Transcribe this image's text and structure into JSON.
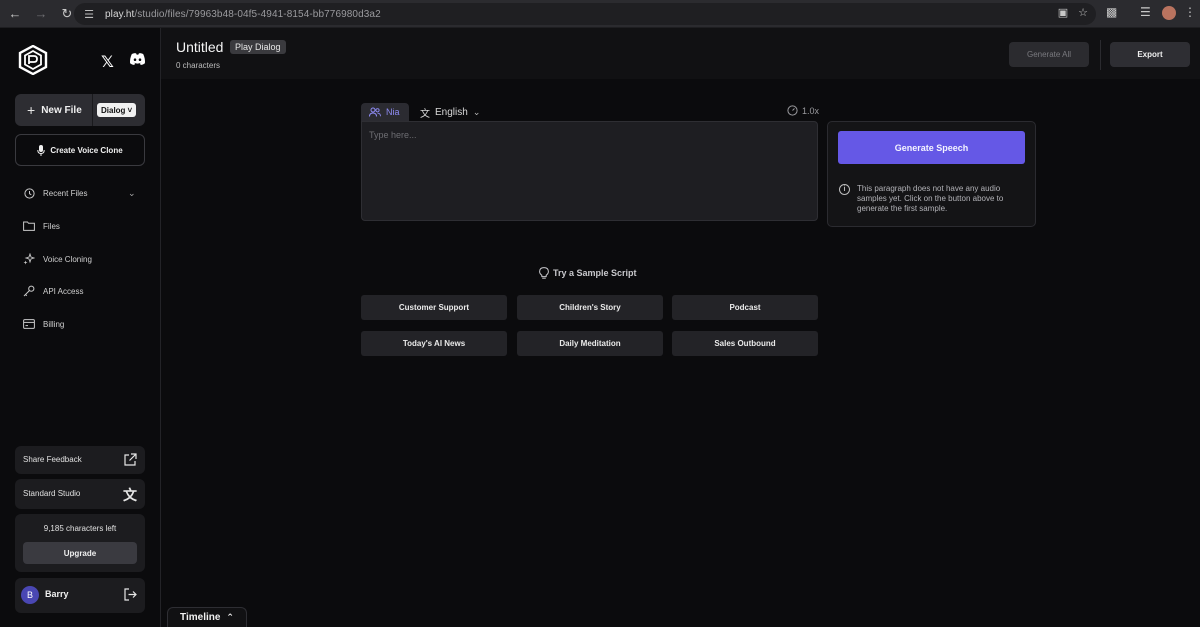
{
  "browser": {
    "url_host": "play.ht",
    "url_path": "/studio/files/79963b48-04f5-4941-8154-bb776980d3a2"
  },
  "sidebar": {
    "new_file_label": "New File",
    "model_select": "Dialog",
    "create_voice_clone": "Create Voice Clone",
    "items": [
      {
        "label": "Recent Files",
        "icon": "clock-icon"
      },
      {
        "label": "Files",
        "icon": "folder-icon"
      },
      {
        "label": "Voice Cloning",
        "icon": "sparkle-icon"
      },
      {
        "label": "API Access",
        "icon": "key-icon"
      },
      {
        "label": "Billing",
        "icon": "billing-icon"
      }
    ],
    "share_feedback": "Share Feedback",
    "studio_mode": "Standard Studio",
    "characters_left": "9,185 characters left",
    "upgrade_label": "Upgrade",
    "user": {
      "initial": "B",
      "name": "Barry"
    }
  },
  "header": {
    "title": "Untitled",
    "model_badge": "Play Dialog",
    "char_count": "0 characters",
    "generate_all": "Generate All",
    "export": "Export"
  },
  "editor": {
    "voice_name": "Nia",
    "language": "English",
    "speed": "1.0x",
    "placeholder": "Type here..."
  },
  "generate": {
    "button": "Generate Speech",
    "info": "This paragraph does not have any audio samples yet. Click on the button above to generate the first sample."
  },
  "samples": {
    "title": "Try a Sample Script",
    "items": [
      "Customer Support",
      "Children's Story",
      "Podcast",
      "Today's AI News",
      "Daily Meditation",
      "Sales Outbound"
    ]
  },
  "timeline": {
    "label": "Timeline"
  },
  "colors": {
    "accent": "#6558e6",
    "background": "#0b0b0d",
    "voice_tab_text": "#8f8cf5"
  }
}
